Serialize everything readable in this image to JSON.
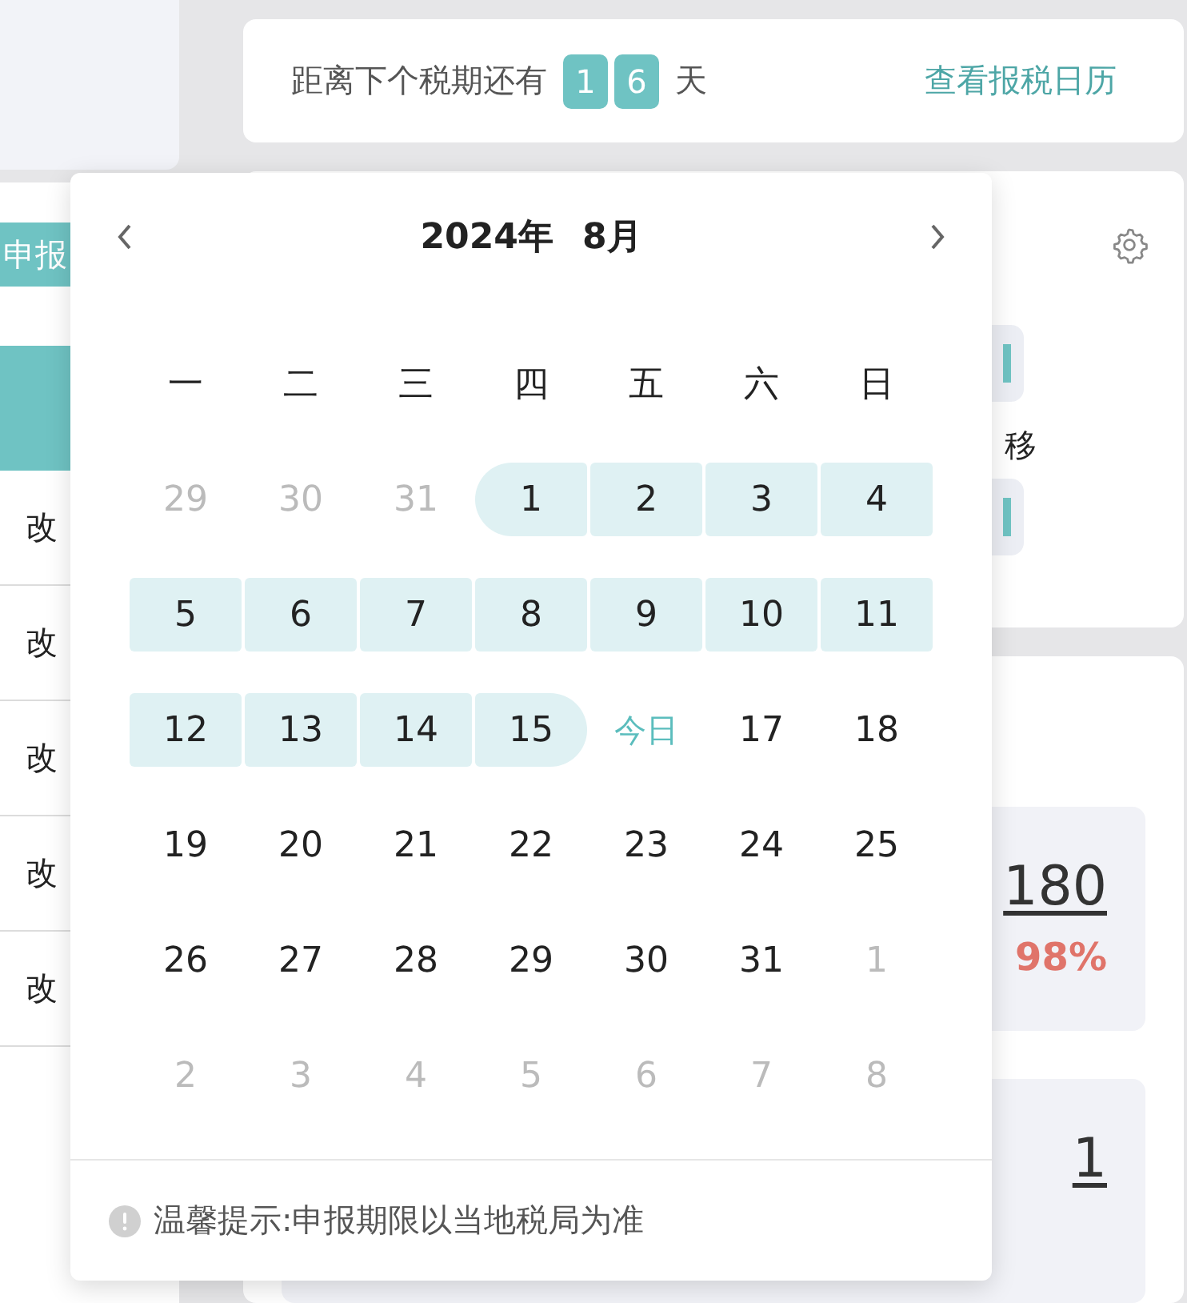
{
  "sidebar": {
    "declare_button": "申报",
    "rows": [
      "改",
      "改",
      "改",
      "改",
      "改"
    ]
  },
  "countdown": {
    "label": "距离下个税期还有",
    "digits": [
      "1",
      "6"
    ],
    "unit": "天",
    "link": "查看报税日历"
  },
  "shortcuts": {
    "items": [
      {
        "kind": "labeled",
        "label": "移"
      },
      {
        "kind": "plain"
      }
    ]
  },
  "stats": {
    "tiles": [
      {
        "value": "180",
        "percent": "98%"
      },
      {
        "value": "1"
      }
    ]
  },
  "calendar": {
    "year": "2024年",
    "month": "8月",
    "weekdays": [
      "一",
      "二",
      "三",
      "四",
      "五",
      "六",
      "日"
    ],
    "days": [
      {
        "label": "29",
        "muted": true,
        "in_range": false,
        "today": false
      },
      {
        "label": "30",
        "muted": true,
        "in_range": false,
        "today": false
      },
      {
        "label": "31",
        "muted": true,
        "in_range": false,
        "today": false
      },
      {
        "label": "1",
        "muted": false,
        "in_range": true,
        "today": false
      },
      {
        "label": "2",
        "muted": false,
        "in_range": true,
        "today": false
      },
      {
        "label": "3",
        "muted": false,
        "in_range": true,
        "today": false
      },
      {
        "label": "4",
        "muted": false,
        "in_range": true,
        "today": false
      },
      {
        "label": "5",
        "muted": false,
        "in_range": true,
        "today": false
      },
      {
        "label": "6",
        "muted": false,
        "in_range": true,
        "today": false
      },
      {
        "label": "7",
        "muted": false,
        "in_range": true,
        "today": false
      },
      {
        "label": "8",
        "muted": false,
        "in_range": true,
        "today": false
      },
      {
        "label": "9",
        "muted": false,
        "in_range": true,
        "today": false
      },
      {
        "label": "10",
        "muted": false,
        "in_range": true,
        "today": false
      },
      {
        "label": "11",
        "muted": false,
        "in_range": true,
        "today": false
      },
      {
        "label": "12",
        "muted": false,
        "in_range": true,
        "today": false
      },
      {
        "label": "13",
        "muted": false,
        "in_range": true,
        "today": false
      },
      {
        "label": "14",
        "muted": false,
        "in_range": true,
        "today": false
      },
      {
        "label": "15",
        "muted": false,
        "in_range": true,
        "today": false
      },
      {
        "label": "今日",
        "muted": false,
        "in_range": false,
        "today": true
      },
      {
        "label": "17",
        "muted": false,
        "in_range": false,
        "today": false
      },
      {
        "label": "18",
        "muted": false,
        "in_range": false,
        "today": false
      },
      {
        "label": "19",
        "muted": false,
        "in_range": false,
        "today": false
      },
      {
        "label": "20",
        "muted": false,
        "in_range": false,
        "today": false
      },
      {
        "label": "21",
        "muted": false,
        "in_range": false,
        "today": false
      },
      {
        "label": "22",
        "muted": false,
        "in_range": false,
        "today": false
      },
      {
        "label": "23",
        "muted": false,
        "in_range": false,
        "today": false
      },
      {
        "label": "24",
        "muted": false,
        "in_range": false,
        "today": false
      },
      {
        "label": "25",
        "muted": false,
        "in_range": false,
        "today": false
      },
      {
        "label": "26",
        "muted": false,
        "in_range": false,
        "today": false
      },
      {
        "label": "27",
        "muted": false,
        "in_range": false,
        "today": false
      },
      {
        "label": "28",
        "muted": false,
        "in_range": false,
        "today": false
      },
      {
        "label": "29",
        "muted": false,
        "in_range": false,
        "today": false
      },
      {
        "label": "30",
        "muted": false,
        "in_range": false,
        "today": false
      },
      {
        "label": "31",
        "muted": false,
        "in_range": false,
        "today": false
      },
      {
        "label": "1",
        "muted": true,
        "in_range": false,
        "today": false
      },
      {
        "label": "2",
        "muted": true,
        "in_range": false,
        "today": false
      },
      {
        "label": "3",
        "muted": true,
        "in_range": false,
        "today": false
      },
      {
        "label": "4",
        "muted": true,
        "in_range": false,
        "today": false
      },
      {
        "label": "5",
        "muted": true,
        "in_range": false,
        "today": false
      },
      {
        "label": "6",
        "muted": true,
        "in_range": false,
        "today": false
      },
      {
        "label": "7",
        "muted": true,
        "in_range": false,
        "today": false
      },
      {
        "label": "8",
        "muted": true,
        "in_range": false,
        "today": false
      }
    ],
    "tip": "温馨提示:申报期限以当地税局为准"
  }
}
